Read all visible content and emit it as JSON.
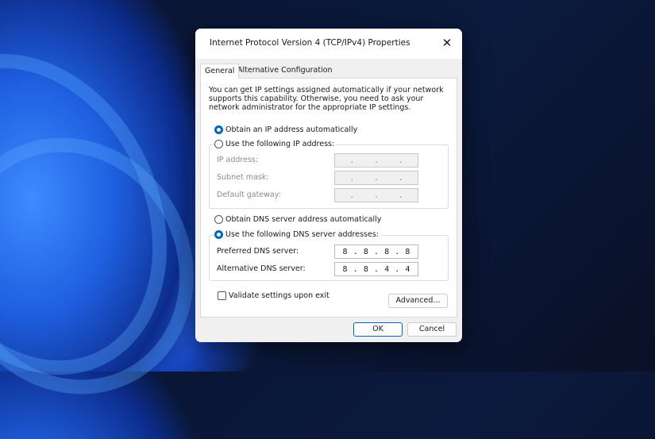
{
  "dialog": {
    "title": "Internet Protocol Version 4 (TCP/IPv4) Properties",
    "close_icon": "close-icon"
  },
  "tabs": [
    {
      "label": "General",
      "active": true
    },
    {
      "label": "Alternative Configuration",
      "active": false
    }
  ],
  "description": "You can get IP settings assigned automatically if your network supports this capability. Otherwise, you need to ask your network administrator for the appropriate IP settings.",
  "ip": {
    "auto_label": "Obtain an IP address automatically",
    "manual_label": "Use the following IP address:",
    "selected": "auto",
    "fields": [
      {
        "label": "IP address:",
        "value": [
          "",
          "",
          "",
          ""
        ]
      },
      {
        "label": "Subnet mask:",
        "value": [
          "",
          "",
          "",
          ""
        ]
      },
      {
        "label": "Default gateway:",
        "value": [
          "",
          "",
          "",
          ""
        ]
      }
    ]
  },
  "dns": {
    "auto_label": "Obtain DNS server address automatically",
    "manual_label": "Use the following DNS server addresses:",
    "selected": "manual",
    "preferred": {
      "label": "Preferred DNS server:",
      "octets": [
        "8",
        "8",
        "8",
        "8"
      ]
    },
    "alternative": {
      "label": "Alternative DNS server:",
      "octets": [
        "8",
        "8",
        "4",
        "4"
      ]
    }
  },
  "validate": {
    "label": "Validate settings upon exit",
    "checked": false
  },
  "buttons": {
    "advanced": "Advanced...",
    "ok": "OK",
    "cancel": "Cancel"
  },
  "colors": {
    "accent": "#0067c0"
  }
}
